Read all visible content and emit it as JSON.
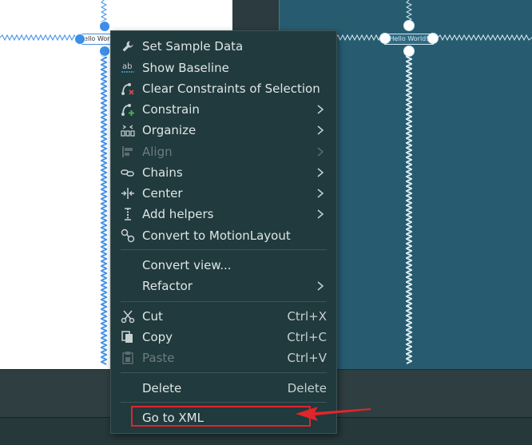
{
  "design_surface": {
    "widget_text": "Hello World!",
    "blueprint_widget_text": "Hello World!"
  },
  "menu": {
    "groups": [
      [
        {
          "id": "set-sample-data",
          "label": "Set Sample Data",
          "icon": "wrench-icon",
          "submenu": false,
          "enabled": true,
          "shortcut": ""
        },
        {
          "id": "show-baseline",
          "label": "Show Baseline",
          "icon": "baseline-ab-icon",
          "submenu": false,
          "enabled": true,
          "shortcut": ""
        },
        {
          "id": "clear-constraints",
          "label": "Clear Constraints of Selection",
          "icon": "clear-constraints-icon",
          "submenu": false,
          "enabled": true,
          "shortcut": ""
        },
        {
          "id": "constrain",
          "label": "Constrain",
          "icon": "constrain-icon",
          "submenu": true,
          "enabled": true,
          "shortcut": ""
        },
        {
          "id": "organize",
          "label": "Organize",
          "icon": "organize-icon",
          "submenu": true,
          "enabled": true,
          "shortcut": ""
        },
        {
          "id": "align",
          "label": "Align",
          "icon": "align-icon",
          "submenu": true,
          "enabled": false,
          "shortcut": ""
        },
        {
          "id": "chains",
          "label": "Chains",
          "icon": "chains-icon",
          "submenu": true,
          "enabled": true,
          "shortcut": ""
        },
        {
          "id": "center",
          "label": "Center",
          "icon": "center-icon",
          "submenu": true,
          "enabled": true,
          "shortcut": ""
        },
        {
          "id": "add-helpers",
          "label": "Add helpers",
          "icon": "guideline-icon",
          "submenu": true,
          "enabled": true,
          "shortcut": ""
        },
        {
          "id": "convert-motion",
          "label": "Convert to MotionLayout",
          "icon": "motion-icon",
          "submenu": false,
          "enabled": true,
          "shortcut": ""
        }
      ],
      [
        {
          "id": "convert-view",
          "label": "Convert view...",
          "icon": "",
          "submenu": false,
          "enabled": true,
          "shortcut": ""
        },
        {
          "id": "refactor",
          "label": "Refactor",
          "icon": "",
          "submenu": true,
          "enabled": true,
          "shortcut": ""
        }
      ],
      [
        {
          "id": "cut",
          "label": "Cut",
          "icon": "scissors-icon",
          "submenu": false,
          "enabled": true,
          "shortcut": "Ctrl+X"
        },
        {
          "id": "copy",
          "label": "Copy",
          "icon": "copy-icon",
          "submenu": false,
          "enabled": true,
          "shortcut": "Ctrl+C"
        },
        {
          "id": "paste",
          "label": "Paste",
          "icon": "paste-icon",
          "submenu": false,
          "enabled": false,
          "shortcut": "Ctrl+V"
        }
      ],
      [
        {
          "id": "delete",
          "label": "Delete",
          "icon": "",
          "submenu": false,
          "enabled": true,
          "shortcut": "Delete"
        }
      ],
      [
        {
          "id": "go-to-xml",
          "label": "Go to XML",
          "icon": "",
          "submenu": false,
          "enabled": true,
          "shortcut": ""
        }
      ]
    ]
  },
  "colors": {
    "menu_bg": "#203a3d",
    "text": "#dfe6e6",
    "disabled_text": "#6c7d7f",
    "annotation_red": "#e0252b",
    "design_blue": "#3d8ee8",
    "blueprint_bg": "#275c70"
  }
}
